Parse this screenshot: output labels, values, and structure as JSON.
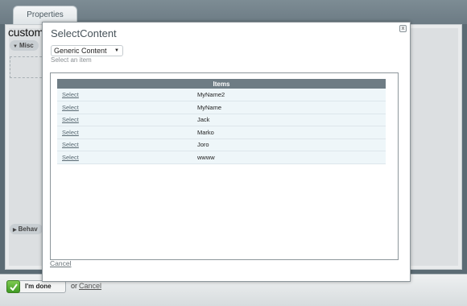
{
  "background": {
    "tab_label": "Properties",
    "title": "custom",
    "misc_label": "Misc",
    "behavior_label": "Behav",
    "done_label": "I'm done",
    "or_text": "or",
    "cancel_label": "Cancel"
  },
  "dialog": {
    "title": "SelectContent",
    "close_label": "x",
    "dropdown_value": "Generic Content",
    "hint": "Select an item",
    "table_header": "Items",
    "rows": [
      {
        "action": "Select",
        "name": "MyName2"
      },
      {
        "action": "Select",
        "name": "MyName"
      },
      {
        "action": "Select",
        "name": "Jack"
      },
      {
        "action": "Select",
        "name": "Marko"
      },
      {
        "action": "Select",
        "name": "Joro"
      },
      {
        "action": "Select",
        "name": "wwww"
      }
    ],
    "cancel_label": "Cancel"
  }
}
